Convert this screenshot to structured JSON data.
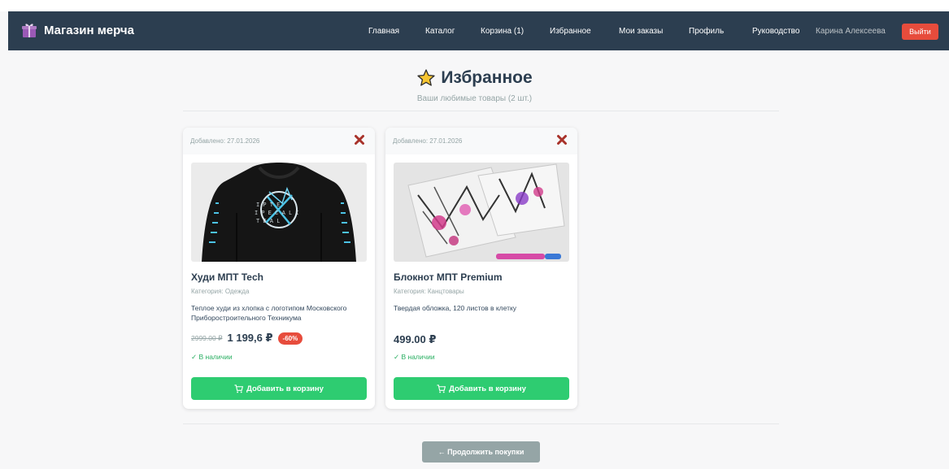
{
  "brand": {
    "name": "Магазин мерча",
    "icon": "gift-icon"
  },
  "nav": {
    "links": [
      "Главная",
      "Каталог",
      "Корзина (1)",
      "Избранное",
      "Мои заказы",
      "Профиль",
      "Руководство"
    ],
    "user": "Карина Алексеева",
    "logout": "Выйти"
  },
  "page": {
    "title": "Избранное",
    "title_icon": "star-icon",
    "subtitle": "Ваши любимые товары (2 шт.)"
  },
  "favorites": [
    {
      "added": "Добавлено: 27.01.2026",
      "name": "Худи МПТ Tech",
      "category": "Категория: Одежда",
      "description": "Теплое худи из хлопка с логотипом Московского Приборостроительного Техникума",
      "old_price": "2999.00 ₽",
      "price": "1 199,6 ₽",
      "discount": "-60%",
      "stock": "✓ В наличии",
      "add_button": "Добавить в корзину"
    },
    {
      "added": "Добавлено: 27.01.2026",
      "name": "Блокнот МПТ Premium",
      "category": "Категория: Канцтовары",
      "description": "Твердая обложка, 120 листов в клетку",
      "price": "499.00 ₽",
      "stock": "✓ В наличии",
      "add_button": "Добавить в корзину"
    }
  ],
  "continue_button": "← Продолжить покупки",
  "colors": {
    "navbar": "#2c3e50",
    "logout": "#e74c3c",
    "add_button": "#2ecc71",
    "stock": "#27ae60",
    "discount": "#e74c3c",
    "continue_button": "#95a5a6"
  }
}
